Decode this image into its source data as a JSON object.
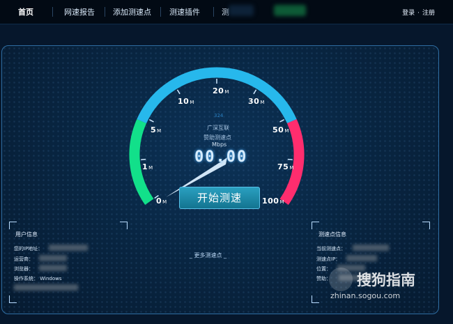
{
  "nav": {
    "items": [
      "首页",
      "网速报告",
      "添加测速点",
      "测速插件",
      "测"
    ],
    "auth": {
      "login": "登录",
      "separator": "·",
      "register": "注册"
    }
  },
  "gauge": {
    "marks": [
      {
        "label": "0",
        "unit": "M"
      },
      {
        "label": "1",
        "unit": "M"
      },
      {
        "label": "5",
        "unit": "M"
      },
      {
        "label": "10",
        "unit": "M"
      },
      {
        "label": "20",
        "unit": "M"
      },
      {
        "label": "30",
        "unit": "M"
      },
      {
        "label": "50",
        "unit": "M"
      },
      {
        "label": "75",
        "unit": "M"
      },
      {
        "label": "100",
        "unit": "M"
      }
    ],
    "ping": "324",
    "isp": "广深互联",
    "sponsor_label": "赞助测速点",
    "unit": "Mbps",
    "value": "00.00",
    "colors": {
      "low": "#12e08a",
      "mid": "#27b8ec",
      "high": "#ff2d6e",
      "needle": "#dcefff"
    }
  },
  "start_button": "开始测速",
  "user_info": {
    "title": "用户信息",
    "fields": [
      "您的IP地址：",
      "运营商：",
      "浏览器：",
      "操作系统："
    ],
    "os_value": "Windows"
  },
  "server_info": {
    "title": "测速点信息",
    "fields": [
      "当前测速点：",
      "测速点IP：",
      "位置：",
      "赞助："
    ]
  },
  "more_link": "更多测速点",
  "watermark": {
    "brand": "搜狗指南",
    "url": "zhinan.sogou.com"
  }
}
